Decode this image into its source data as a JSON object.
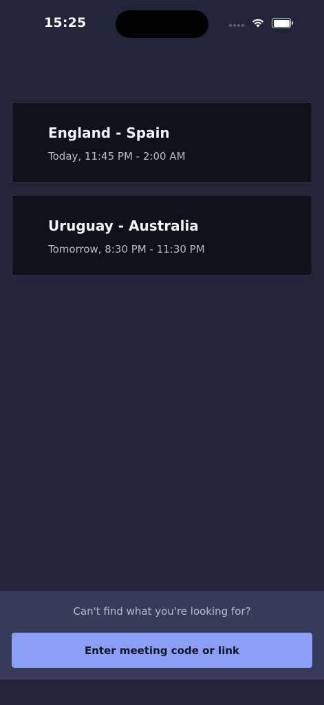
{
  "status_bar": {
    "time": "15:25",
    "icons": [
      "signal-dots-icon",
      "wifi-icon",
      "battery-icon"
    ]
  },
  "meetings": [
    {
      "title": "England - Spain",
      "time": "Today, 11:45 PM - 2:00 AM"
    },
    {
      "title": "Uruguay - Australia",
      "time": "Tomorrow, 8:30 PM - 11:30 PM"
    }
  ],
  "footer": {
    "help_text": "Can't find what you're looking for?",
    "button_label": "Enter meeting code or link"
  },
  "colors": {
    "background": "#212537",
    "card": "#0e1119",
    "panel": "#363b57",
    "accent": "#8c9ff6"
  }
}
